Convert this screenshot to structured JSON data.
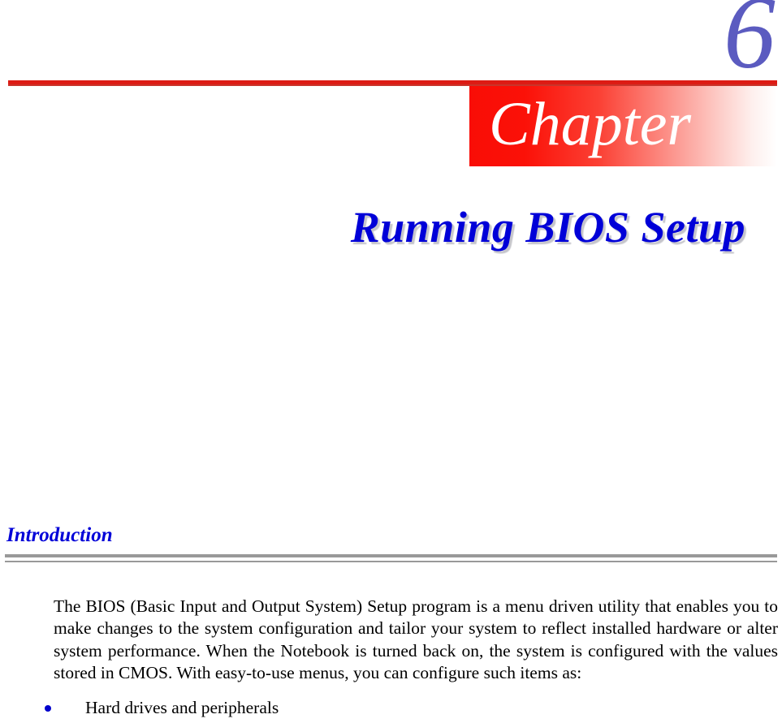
{
  "page": {
    "chapter_number": "6",
    "banner_label": "Chapter",
    "chapter_title": "Running BIOS Setup"
  },
  "section": {
    "heading": "Introduction",
    "paragraph": "The BIOS (Basic Input and Output System) Setup program is a menu driven utility that enables you to make changes to the system configuration and tailor your system to reflect installed hardware or alter system performance.  When the Notebook is turned back on, the system is configured with the values stored in CMOS.  With easy-to-use menus, you can configure such items as:",
    "bullets": [
      {
        "text": "Hard drives and peripherals"
      }
    ]
  },
  "colors": {
    "chapter_number": "#5b5bc0",
    "banner_red": "#f90d06",
    "rule_red": "#dd1b14",
    "title_blue": "#0000d8",
    "heading_blue": "#0000d8",
    "rule_gray": "#999999",
    "bullet_blue": "#0000cc",
    "body_text": "#000000",
    "page_background": "#ffffff"
  }
}
